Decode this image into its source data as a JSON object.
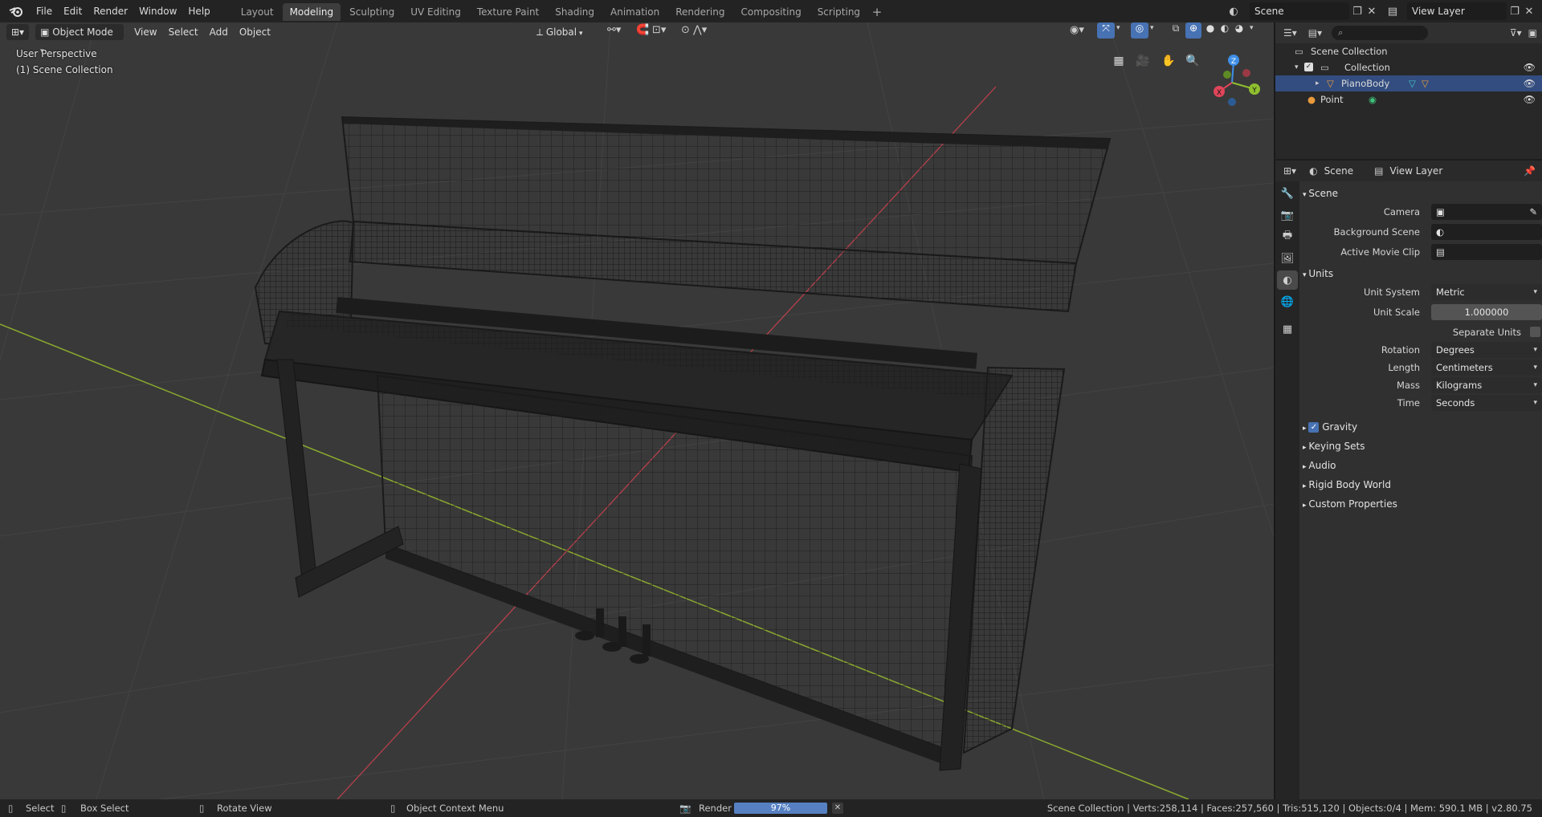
{
  "topbar": {
    "menus": [
      "File",
      "Edit",
      "Render",
      "Window",
      "Help"
    ],
    "workspaces": [
      "Layout",
      "Modeling",
      "Sculpting",
      "UV Editing",
      "Texture Paint",
      "Shading",
      "Animation",
      "Rendering",
      "Compositing",
      "Scripting"
    ],
    "active_workspace": "Modeling",
    "add_workspace": "+",
    "scene": "Scene",
    "view_layer": "View Layer"
  },
  "viewport": {
    "mode": "Object Mode",
    "menus": [
      "View",
      "Select",
      "Add",
      "Object"
    ],
    "transform_orientation": "Global",
    "view_name": "User Perspective",
    "collection_label": "(1) Scene Collection",
    "gizmo": {
      "x": "X",
      "y": "Y",
      "z": "Z"
    }
  },
  "outliner": {
    "search_placeholder": "",
    "rows": [
      {
        "label": "Scene Collection",
        "icon": "collection-icon"
      },
      {
        "label": "Collection",
        "icon": "collection-icon"
      },
      {
        "label": "PianoBody",
        "icon": "mesh-icon",
        "selected": true
      },
      {
        "label": "Point",
        "icon": "light-icon"
      }
    ]
  },
  "properties": {
    "header_scene": "Scene",
    "header_view_layer": "View Layer",
    "scene_section": "Scene",
    "camera_label": "Camera",
    "background_scene_label": "Background Scene",
    "active_movie_clip_label": "Active Movie Clip",
    "units_section": "Units",
    "unit_system_label": "Unit System",
    "unit_system_value": "Metric",
    "unit_scale_label": "Unit Scale",
    "unit_scale_value": "1.000000",
    "separate_units_label": "Separate Units",
    "rotation_label": "Rotation",
    "rotation_value": "Degrees",
    "length_label": "Length",
    "length_value": "Centimeters",
    "mass_label": "Mass",
    "mass_value": "Kilograms",
    "time_label": "Time",
    "time_value": "Seconds",
    "gravity_label": "Gravity",
    "keying_sets_label": "Keying Sets",
    "audio_label": "Audio",
    "rigid_body_world_label": "Rigid Body World",
    "custom_properties_label": "Custom Properties"
  },
  "statusbar": {
    "select": "Select",
    "box_select": "Box Select",
    "rotate_view": "Rotate View",
    "context_menu": "Object Context Menu",
    "render_label": "Render",
    "render_progress": "97%",
    "render_progress_fraction": 0.97,
    "stats": "Scene Collection | Verts:258,114 | Faces:257,560 | Tris:515,120 | Objects:0/4 | Mem: 590.1 MB | v2.80.75"
  },
  "colors": {
    "accent": "#4772b3",
    "selection": "#334d80",
    "progress": "#5680c2",
    "x_axis": "#e0455a",
    "y_axis": "#8fbf2f",
    "z_axis": "#3e8ee6"
  }
}
